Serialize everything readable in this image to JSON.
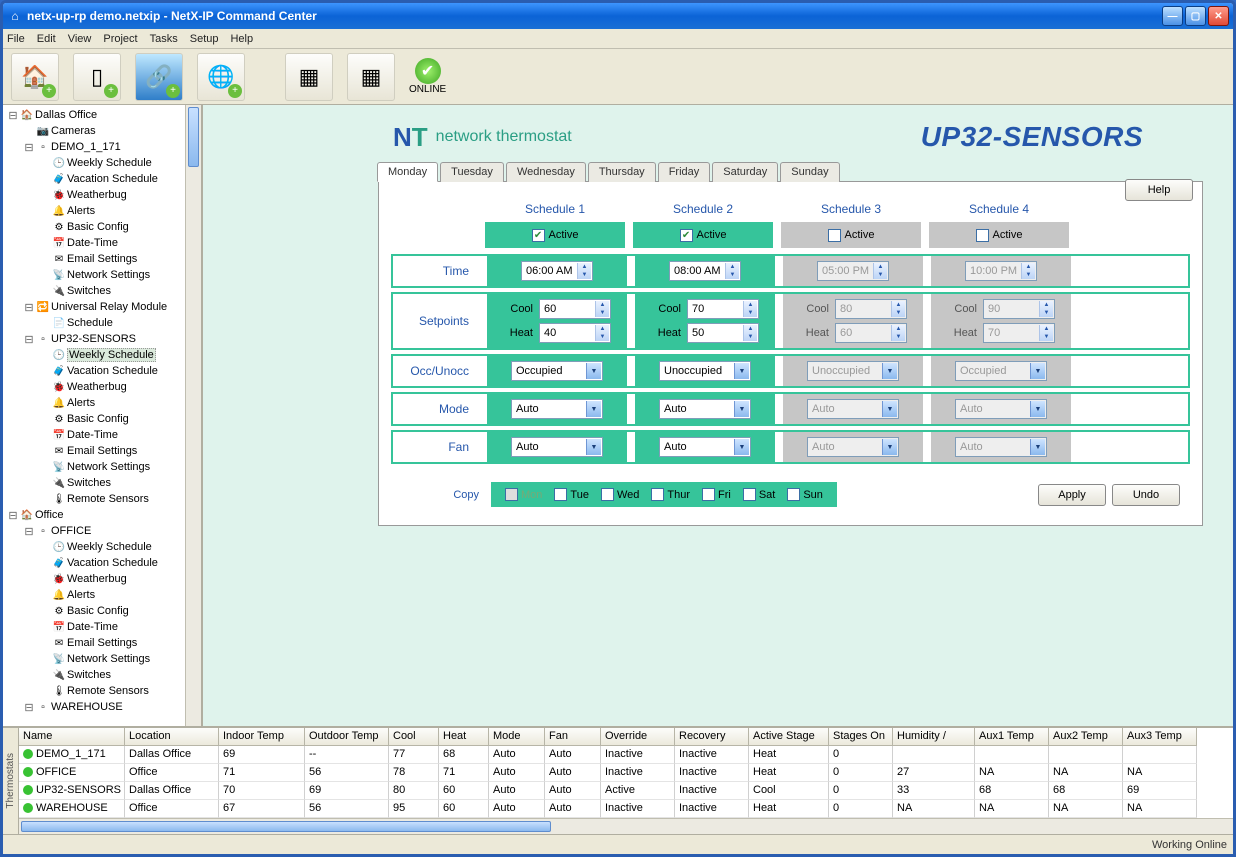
{
  "window": {
    "title": "netx-up-rp demo.netxip - NetX-IP Command Center"
  },
  "menus": [
    "File",
    "Edit",
    "View",
    "Project",
    "Tasks",
    "Setup",
    "Help"
  ],
  "online_label": "ONLINE",
  "tree": [
    {
      "ind": 0,
      "exp": "-",
      "icon": "🏠",
      "label": "Dallas Office"
    },
    {
      "ind": 1,
      "exp": "",
      "icon": "📷",
      "label": "Cameras"
    },
    {
      "ind": 1,
      "exp": "-",
      "icon": "▫",
      "label": "DEMO_1_171"
    },
    {
      "ind": 2,
      "exp": "",
      "icon": "🕒",
      "label": "Weekly Schedule"
    },
    {
      "ind": 2,
      "exp": "",
      "icon": "🧳",
      "label": "Vacation Schedule"
    },
    {
      "ind": 2,
      "exp": "",
      "icon": "🐞",
      "label": "Weatherbug"
    },
    {
      "ind": 2,
      "exp": "",
      "icon": "🔔",
      "label": "Alerts"
    },
    {
      "ind": 2,
      "exp": "",
      "icon": "⚙",
      "label": "Basic Config"
    },
    {
      "ind": 2,
      "exp": "",
      "icon": "📅",
      "label": "Date-Time"
    },
    {
      "ind": 2,
      "exp": "",
      "icon": "✉",
      "label": "Email Settings"
    },
    {
      "ind": 2,
      "exp": "",
      "icon": "📡",
      "label": "Network Settings"
    },
    {
      "ind": 2,
      "exp": "",
      "icon": "🔌",
      "label": "Switches"
    },
    {
      "ind": 1,
      "exp": "-",
      "icon": "🔁",
      "label": "Universal Relay Module"
    },
    {
      "ind": 2,
      "exp": "",
      "icon": "📄",
      "label": "Schedule"
    },
    {
      "ind": 1,
      "exp": "-",
      "icon": "▫",
      "label": "UP32-SENSORS"
    },
    {
      "ind": 2,
      "exp": "",
      "icon": "🕒",
      "label": "Weekly Schedule",
      "sel": true
    },
    {
      "ind": 2,
      "exp": "",
      "icon": "🧳",
      "label": "Vacation Schedule"
    },
    {
      "ind": 2,
      "exp": "",
      "icon": "🐞",
      "label": "Weatherbug"
    },
    {
      "ind": 2,
      "exp": "",
      "icon": "🔔",
      "label": "Alerts"
    },
    {
      "ind": 2,
      "exp": "",
      "icon": "⚙",
      "label": "Basic Config"
    },
    {
      "ind": 2,
      "exp": "",
      "icon": "📅",
      "label": "Date-Time"
    },
    {
      "ind": 2,
      "exp": "",
      "icon": "✉",
      "label": "Email Settings"
    },
    {
      "ind": 2,
      "exp": "",
      "icon": "📡",
      "label": "Network Settings"
    },
    {
      "ind": 2,
      "exp": "",
      "icon": "🔌",
      "label": "Switches"
    },
    {
      "ind": 2,
      "exp": "",
      "icon": "🌡",
      "label": "Remote Sensors"
    },
    {
      "ind": 0,
      "exp": "-",
      "icon": "🏠",
      "label": "Office"
    },
    {
      "ind": 1,
      "exp": "-",
      "icon": "▫",
      "label": "OFFICE"
    },
    {
      "ind": 2,
      "exp": "",
      "icon": "🕒",
      "label": "Weekly Schedule"
    },
    {
      "ind": 2,
      "exp": "",
      "icon": "🧳",
      "label": "Vacation Schedule"
    },
    {
      "ind": 2,
      "exp": "",
      "icon": "🐞",
      "label": "Weatherbug"
    },
    {
      "ind": 2,
      "exp": "",
      "icon": "🔔",
      "label": "Alerts"
    },
    {
      "ind": 2,
      "exp": "",
      "icon": "⚙",
      "label": "Basic Config"
    },
    {
      "ind": 2,
      "exp": "",
      "icon": "📅",
      "label": "Date-Time"
    },
    {
      "ind": 2,
      "exp": "",
      "icon": "✉",
      "label": "Email Settings"
    },
    {
      "ind": 2,
      "exp": "",
      "icon": "📡",
      "label": "Network Settings"
    },
    {
      "ind": 2,
      "exp": "",
      "icon": "🔌",
      "label": "Switches"
    },
    {
      "ind": 2,
      "exp": "",
      "icon": "🌡",
      "label": "Remote Sensors"
    },
    {
      "ind": 1,
      "exp": "-",
      "icon": "▫",
      "label": "WAREHOUSE"
    }
  ],
  "brand_text": "network thermostat",
  "page_title": "UP32-SENSORS",
  "help_label": "Help",
  "day_tabs": [
    "Monday",
    "Tuesday",
    "Wednesday",
    "Thursday",
    "Friday",
    "Saturday",
    "Sunday"
  ],
  "active_tab_index": 0,
  "row_labels": {
    "time": "Time",
    "setpoints": "Setpoints",
    "occ": "Occ/Unocc",
    "mode": "Mode",
    "fan": "Fan",
    "cool": "Cool",
    "heat": "Heat",
    "active": "Active"
  },
  "schedules": [
    {
      "heading": "Schedule 1",
      "active": true,
      "time": "06:00 AM",
      "cool": "60",
      "heat": "40",
      "occ": "Occupied",
      "mode": "Auto",
      "fan": "Auto"
    },
    {
      "heading": "Schedule 2",
      "active": true,
      "time": "08:00 AM",
      "cool": "70",
      "heat": "50",
      "occ": "Unoccupied",
      "mode": "Auto",
      "fan": "Auto"
    },
    {
      "heading": "Schedule 3",
      "active": false,
      "time": "05:00 PM",
      "cool": "80",
      "heat": "60",
      "occ": "Unoccupied",
      "mode": "Auto",
      "fan": "Auto"
    },
    {
      "heading": "Schedule 4",
      "active": false,
      "time": "10:00 PM",
      "cool": "90",
      "heat": "70",
      "occ": "Occupied",
      "mode": "Auto",
      "fan": "Auto"
    }
  ],
  "copy": {
    "label": "Copy",
    "days": [
      "Mon",
      "Tue",
      "Wed",
      "Thur",
      "Fri",
      "Sat",
      "Sun"
    ]
  },
  "buttons": {
    "apply": "Apply",
    "undo": "Undo"
  },
  "grid": {
    "side_tab": "Thermostats",
    "headers": [
      "Name",
      "Location",
      "Indoor Temp",
      "Outdoor Temp",
      "Cool",
      "Heat",
      "Mode",
      "Fan",
      "Override",
      "Recovery",
      "Active Stage",
      "Stages On",
      "Humidity    /",
      "Aux1 Temp",
      "Aux2 Temp",
      "Aux3 Temp"
    ],
    "rows": [
      [
        "DEMO_1_171",
        "Dallas Office",
        "69",
        "--",
        "77",
        "68",
        "Auto",
        "Auto",
        "Inactive",
        "Inactive",
        "Heat",
        "0",
        "",
        "",
        "",
        ""
      ],
      [
        "OFFICE",
        "Office",
        "71",
        "56",
        "78",
        "71",
        "Auto",
        "Auto",
        "Inactive",
        "Inactive",
        "Heat",
        "0",
        "27",
        "NA",
        "NA",
        "NA"
      ],
      [
        "UP32-SENSORS",
        "Dallas Office",
        "70",
        "69",
        "80",
        "60",
        "Auto",
        "Auto",
        "Active",
        "Inactive",
        "Cool",
        "0",
        "33",
        "68",
        "68",
        "69"
      ],
      [
        "WAREHOUSE",
        "Office",
        "67",
        "56",
        "95",
        "60",
        "Auto",
        "Auto",
        "Inactive",
        "Inactive",
        "Heat",
        "0",
        "NA",
        "NA",
        "NA",
        "NA"
      ]
    ]
  },
  "status": "Working Online"
}
